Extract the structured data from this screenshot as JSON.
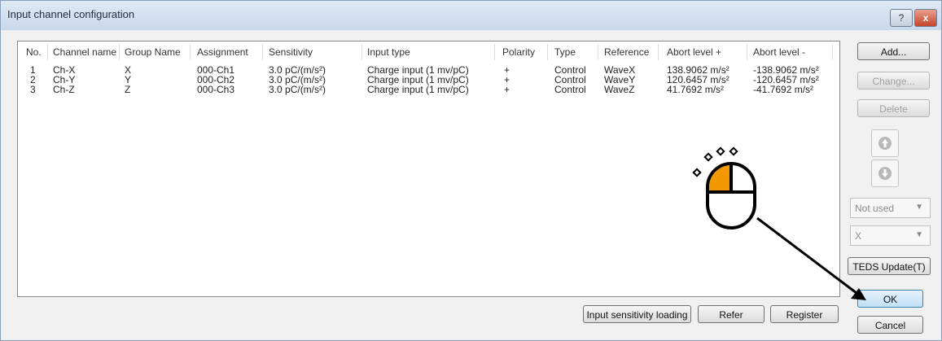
{
  "window": {
    "title": "Input channel configuration",
    "help_label": "?",
    "close_label": "x"
  },
  "table": {
    "headers": [
      "No.",
      "Channel name",
      "Group Name",
      "Assignment",
      "Sensitivity",
      "Input type",
      "Polarity",
      "Type",
      "Reference",
      "Abort level +",
      "Abort level -"
    ],
    "rows": [
      [
        "1",
        "Ch-X",
        "X",
        "000-Ch1",
        "3.0 pC/(m/s²)",
        "Charge input (1 mv/pC)",
        "+",
        "Control",
        "WaveX",
        "138.9062 m/s²",
        "-138.9062 m/s²"
      ],
      [
        "2",
        "Ch-Y",
        "Y",
        "000-Ch2",
        "3.0 pC/(m/s²)",
        "Charge input (1 mv/pC)",
        "+",
        "Control",
        "WaveY",
        "120.6457 m/s²",
        "-120.6457 m/s²"
      ],
      [
        "3",
        "Ch-Z",
        "Z",
        "000-Ch3",
        "3.0 pC/(m/s²)",
        "Charge input (1 mv/pC)",
        "+",
        "Control",
        "WaveZ",
        "41.7692 m/s²",
        "-41.7692 m/s²"
      ]
    ]
  },
  "side": {
    "add": "Add...",
    "change": "Change...",
    "delete": "Delete",
    "combo1": "Not used",
    "combo2": "X",
    "teds": "TEDS Update(T)",
    "ok": "OK",
    "cancel": "Cancel"
  },
  "bottom": {
    "sensitivity_loading": "Input sensitivity loading",
    "refer": "Refer",
    "register": "Register"
  },
  "icons": {
    "up": "arrow-up-icon",
    "down": "arrow-down-icon",
    "cursor": "mouse-click-icon"
  },
  "colors": {
    "accent_orange": "#f39800",
    "ok_border": "#3c7fb1"
  }
}
